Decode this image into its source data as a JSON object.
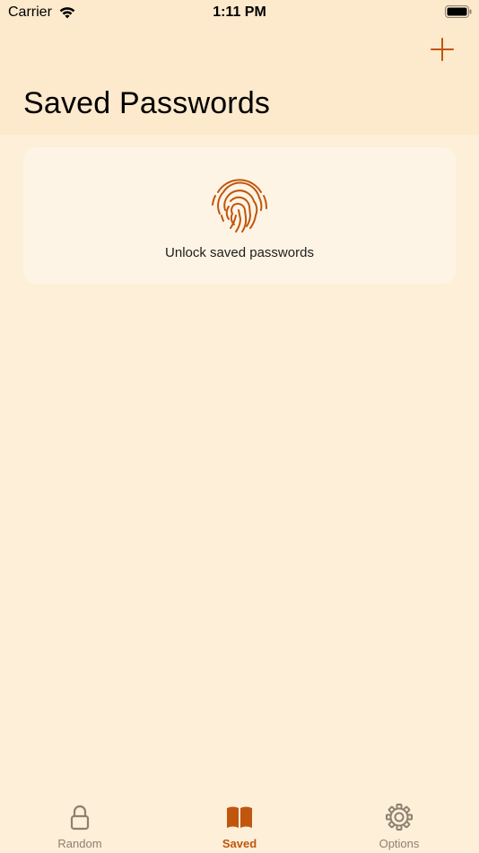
{
  "status_bar": {
    "carrier": "Carrier",
    "time": "1:11 PM"
  },
  "header": {
    "title": "Saved Passwords",
    "add_icon": "plus-icon"
  },
  "unlock_card": {
    "label": "Unlock saved passwords",
    "icon": "fingerprint-icon"
  },
  "tab_bar": {
    "tabs": [
      {
        "label": "Random",
        "icon": "lock-icon",
        "active": false
      },
      {
        "label": "Saved",
        "icon": "book-icon",
        "active": true
      },
      {
        "label": "Options",
        "icon": "gear-icon",
        "active": false
      }
    ]
  },
  "colors": {
    "accent": "#c0560e",
    "background": "#fdefd8",
    "header_background": "#fde9cc",
    "card_background": "#fef4e5",
    "inactive_tab": "#8c8170"
  }
}
